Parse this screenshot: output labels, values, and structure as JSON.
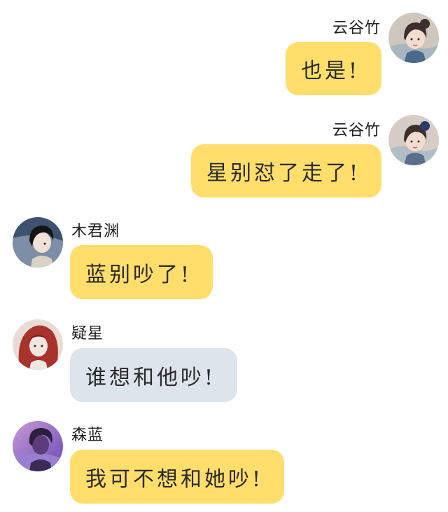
{
  "messages": [
    {
      "side": "right",
      "sender": "云谷竹",
      "avatar": "woman-hair-bun-avatar",
      "text": "也是!",
      "bubble_color": "#FFDE6C"
    },
    {
      "side": "right",
      "sender": "云谷竹",
      "avatar": "woman-hair-bun-avatar",
      "text": "星别怼了走了!",
      "bubble_color": "#FFDE6C"
    },
    {
      "side": "left",
      "sender": "木君渊",
      "avatar": "dark-hair-boy-avatar",
      "text": "蓝别吵了!",
      "bubble_color": "#FFDE6C"
    },
    {
      "side": "left",
      "sender": "疑星",
      "avatar": "red-hair-girl-avatar",
      "text": "谁想和他吵!",
      "bubble_color": "#DDE4EC"
    },
    {
      "side": "left",
      "sender": "森蓝",
      "avatar": "purple-tone-avatar",
      "text": "我可不想和她吵!",
      "bubble_color": "#FFDE6C"
    }
  ]
}
